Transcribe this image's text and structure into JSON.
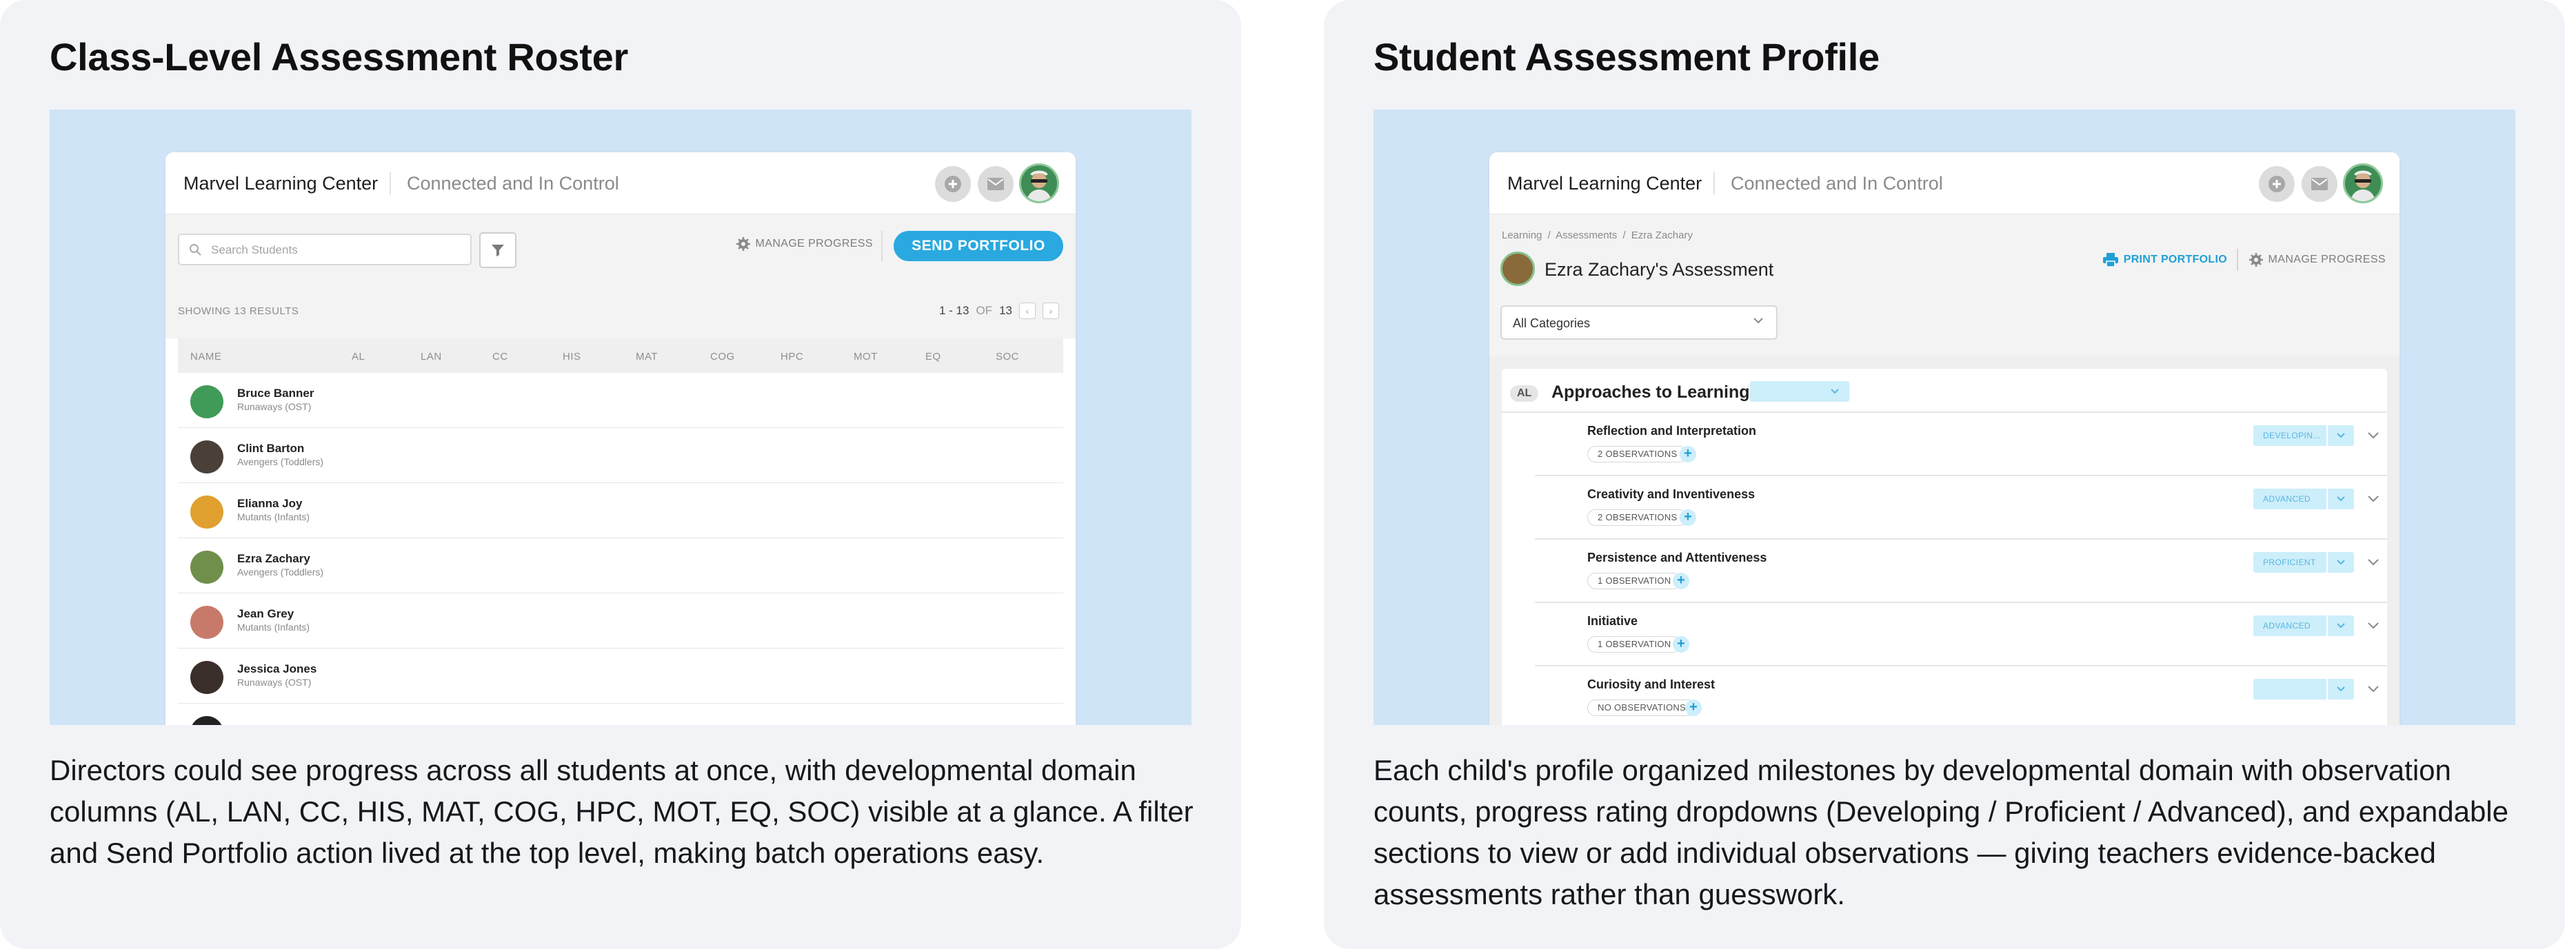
{
  "left": {
    "title": "Class-Level Assessment Roster",
    "caption": "Directors could see progress across all students at once, with developmental domain columns (AL, LAN, CC, HIS, MAT, COG, HPC, MOT, EQ, SOC) visible at a glance. A filter and Send Portfolio action lived at the top level, making batch operations easy.",
    "app": {
      "brand": "Marvel Learning Center",
      "tagline": "Connected and In Control",
      "search_placeholder": "Search Students",
      "manage_progress": "MANAGE PROGRESS",
      "send_portfolio": "SEND PORTFOLIO",
      "results": "SHOWING 13 RESULTS",
      "pager": {
        "range": "1 - 13",
        "of": "OF",
        "total": "13"
      },
      "columns": [
        "NAME",
        "AL",
        "LAN",
        "CC",
        "HIS",
        "MAT",
        "COG",
        "HPC",
        "MOT",
        "EQ",
        "SOC"
      ],
      "students": [
        {
          "name": "Bruce Banner",
          "group": "Runaways (OST)",
          "color": "#3f9b57"
        },
        {
          "name": "Clint Barton",
          "group": "Avengers (Toddlers)",
          "color": "#4b4038"
        },
        {
          "name": "Elianna Joy",
          "group": "Mutants (Infants)",
          "color": "#e0a030"
        },
        {
          "name": "Ezra Zachary",
          "group": "Avengers (Toddlers)",
          "color": "#6f8f4a"
        },
        {
          "name": "Jean Grey",
          "group": "Mutants (Infants)",
          "color": "#c77a6a"
        },
        {
          "name": "Jessica Jones",
          "group": "Runaways (OST)",
          "color": "#3a2f2a"
        }
      ]
    }
  },
  "right": {
    "title": "Student Assessment Profile",
    "caption": "Each child's profile organized milestones by developmental domain with observation counts, progress rating dropdowns (Developing / Proficient / Advanced), and expandable sections to view or add individual observations — giving teachers evidence-backed assessments rather than guesswork.",
    "app": {
      "brand": "Marvel Learning Center",
      "tagline": "Connected and In Control",
      "breadcrumb": [
        "Learning",
        "/",
        "Assessments",
        "/",
        "Ezra Zachary"
      ],
      "student_title": "Ezra Zachary's Assessment",
      "print_portfolio": "PRINT PORTFOLIO",
      "manage_progress": "MANAGE PROGRESS",
      "category_select": "All Categories",
      "domain": {
        "code": "AL",
        "name": "Approaches to Learning"
      },
      "items": [
        {
          "title": "Reflection and Interpretation",
          "observations": "2 OBSERVATIONS",
          "rating": "DEVELOPIN..."
        },
        {
          "title": "Creativity and Inventiveness",
          "observations": "2 OBSERVATIONS",
          "rating": "ADVANCED"
        },
        {
          "title": "Persistence and Attentiveness",
          "observations": "1 OBSERVATION",
          "rating": "PROFICIENT"
        },
        {
          "title": "Initiative",
          "observations": "1 OBSERVATION",
          "rating": "ADVANCED"
        },
        {
          "title": "Curiosity and Interest",
          "observations": "NO OBSERVATIONS",
          "rating": ""
        }
      ]
    }
  },
  "colors": {
    "accent": "#29a9e0",
    "preview_bg": "#cfe4f6",
    "card_bg": "#f1f3f7",
    "rating_bg": "#cdeefb"
  }
}
